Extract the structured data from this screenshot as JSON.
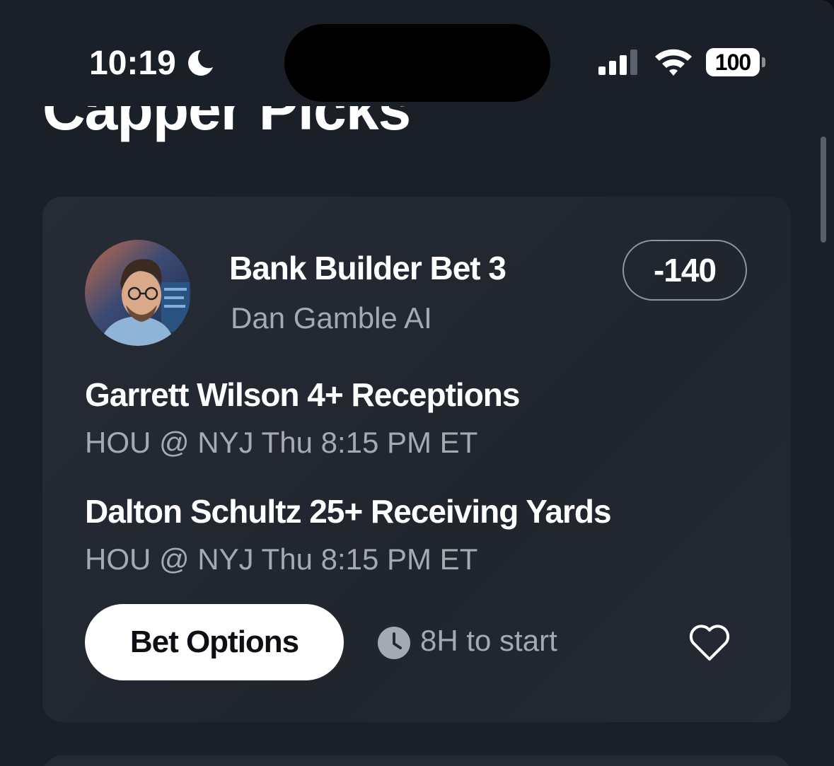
{
  "status_bar": {
    "time": "10:19",
    "battery": "100"
  },
  "section": {
    "title": "Capper Picks"
  },
  "card": {
    "bet_title": "Bank Builder Bet 3",
    "capper_name": "Dan Gamble AI",
    "odds": "-140",
    "picks": [
      {
        "title": "Garrett Wilson 4+ Receptions",
        "meta": "HOU @ NYJ Thu 8:15 PM ET"
      },
      {
        "title": "Dalton Schultz 25+ Receiving Yards",
        "meta": "HOU @ NYJ Thu 8:15 PM ET"
      }
    ],
    "bet_options_label": "Bet Options",
    "start_text": "8H to start"
  },
  "icons": {
    "moon": "moon-icon",
    "signal": "cellular-signal-icon",
    "wifi": "wifi-icon",
    "battery": "battery-icon",
    "clock": "clock-icon",
    "heart": "heart-outline-icon",
    "avatar": "avatar"
  },
  "colors": {
    "background": "#1b1f27",
    "card": "#242933",
    "secondary_text": "#a5a9b1",
    "button": "#ffffff"
  }
}
